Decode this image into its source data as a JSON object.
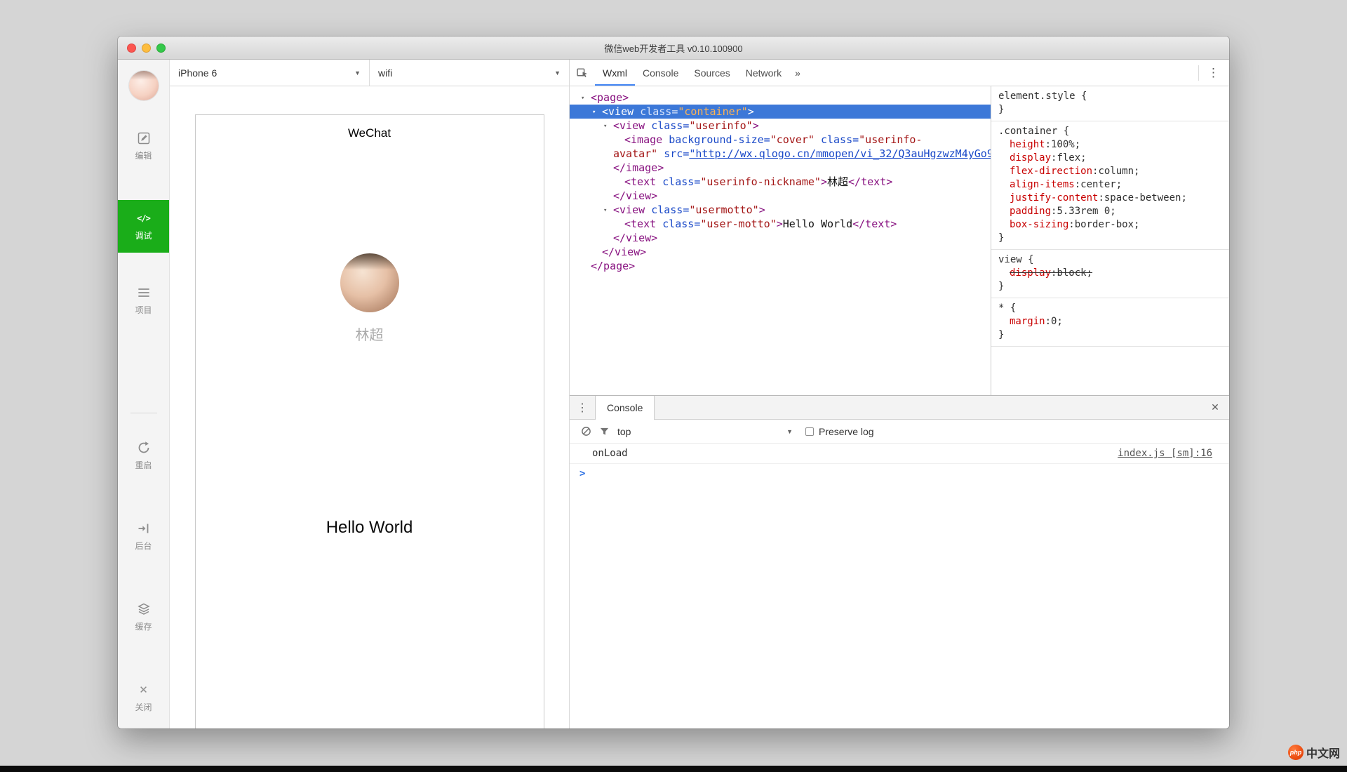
{
  "window": {
    "title": "微信web开发者工具 v0.10.100900"
  },
  "sidebar": {
    "items": [
      {
        "id": "edit",
        "label": "编辑"
      },
      {
        "id": "debug",
        "label": "调试",
        "active": true
      },
      {
        "id": "project",
        "label": "项目"
      },
      {
        "id": "restart",
        "label": "重启"
      },
      {
        "id": "backend",
        "label": "后台"
      },
      {
        "id": "cache",
        "label": "缓存"
      },
      {
        "id": "close",
        "label": "关闭"
      }
    ],
    "debug_icon": "</>"
  },
  "toolbar": {
    "device": "iPhone 6",
    "network": "wifi"
  },
  "simulator": {
    "nav_title": "WeChat",
    "nickname": "林超",
    "motto": "Hello World"
  },
  "devtools": {
    "tabs": [
      {
        "label": "Wxml",
        "active": true
      },
      {
        "label": "Console"
      },
      {
        "label": "Sources"
      },
      {
        "label": "Network"
      },
      {
        "label": "»"
      }
    ],
    "wxml_tree": {
      "lines": [
        {
          "pad": 30,
          "arrow": true,
          "seg": [
            [
              "<page>",
              "tag"
            ]
          ]
        },
        {
          "pad": 46,
          "arrow": true,
          "selected": true,
          "seg": [
            [
              "<view ",
              "tag"
            ],
            [
              "class=",
              "attr"
            ],
            [
              "\"container\"",
              "val"
            ],
            [
              ">",
              "tag"
            ]
          ]
        },
        {
          "pad": 62,
          "arrow": true,
          "seg": [
            [
              "<view ",
              "tag"
            ],
            [
              "class=",
              "attr"
            ],
            [
              "\"userinfo\"",
              "val"
            ],
            [
              ">",
              "tag"
            ]
          ]
        },
        {
          "pad": 78,
          "seg": [
            [
              "<image ",
              "tag"
            ],
            [
              "background-size=",
              "attr"
            ],
            [
              "\"cover\" ",
              "val"
            ],
            [
              "class=",
              "attr"
            ],
            [
              "\"userinfo-",
              "val"
            ]
          ]
        },
        {
          "pad": 62,
          "seg": [
            [
              "avatar\" ",
              "val"
            ],
            [
              "src=",
              "attr"
            ],
            [
              "\"http://wx.qlogo.cn/mmopen/vi_32/Q3auHgzwzM4yGo9Y8",
              "link"
            ]
          ]
        },
        {
          "pad": 62,
          "seg": [
            [
              "</image>",
              "tag"
            ]
          ]
        },
        {
          "pad": 78,
          "seg": [
            [
              "<text ",
              "tag"
            ],
            [
              "class=",
              "attr"
            ],
            [
              "\"userinfo-nickname\"",
              "val"
            ],
            [
              ">",
              "tag"
            ],
            [
              "林超",
              "txt"
            ],
            [
              "</text>",
              "tag"
            ]
          ]
        },
        {
          "pad": 62,
          "seg": [
            [
              "</view>",
              "tag"
            ]
          ]
        },
        {
          "pad": 62,
          "arrow": true,
          "seg": [
            [
              "<view ",
              "tag"
            ],
            [
              "class=",
              "attr"
            ],
            [
              "\"usermotto\"",
              "val"
            ],
            [
              ">",
              "tag"
            ]
          ]
        },
        {
          "pad": 78,
          "seg": [
            [
              "<text ",
              "tag"
            ],
            [
              "class=",
              "attr"
            ],
            [
              "\"user-motto\"",
              "val"
            ],
            [
              ">",
              "tag"
            ],
            [
              "Hello World",
              "txt"
            ],
            [
              "</text>",
              "tag"
            ]
          ]
        },
        {
          "pad": 62,
          "seg": [
            [
              "</view>",
              "tag"
            ]
          ]
        },
        {
          "pad": 46,
          "seg": [
            [
              "</view>",
              "tag"
            ]
          ]
        },
        {
          "pad": 30,
          "seg": [
            [
              "</page>",
              "tag"
            ]
          ]
        }
      ]
    },
    "styles": [
      {
        "selector": "element.style",
        "props": []
      },
      {
        "selector": ".container",
        "props": [
          {
            "n": "height",
            "v": "100%"
          },
          {
            "n": "display",
            "v": "flex"
          },
          {
            "n": "flex-direction",
            "v": "column"
          },
          {
            "n": "align-items",
            "v": "center"
          },
          {
            "n": "justify-content",
            "v": "space-between"
          },
          {
            "n": "padding",
            "v": "5.33rem 0"
          },
          {
            "n": "box-sizing",
            "v": "border-box"
          }
        ]
      },
      {
        "selector": "view",
        "props": [
          {
            "n": "display",
            "v": "block",
            "struck": true
          }
        ]
      },
      {
        "selector": "*",
        "props": [
          {
            "n": "margin",
            "v": "0"
          }
        ]
      }
    ],
    "console": {
      "tab_label": "Console",
      "context": "top",
      "preserve_label": "Preserve log",
      "logs": [
        {
          "message": "onLoad",
          "source": "index.js [sm]:16"
        }
      ],
      "prompt": ">"
    }
  },
  "watermark": {
    "badge": "php",
    "text": "中文网"
  },
  "colors": {
    "wechat_green": "#1aad19",
    "selection_blue": "#3c78d8"
  }
}
